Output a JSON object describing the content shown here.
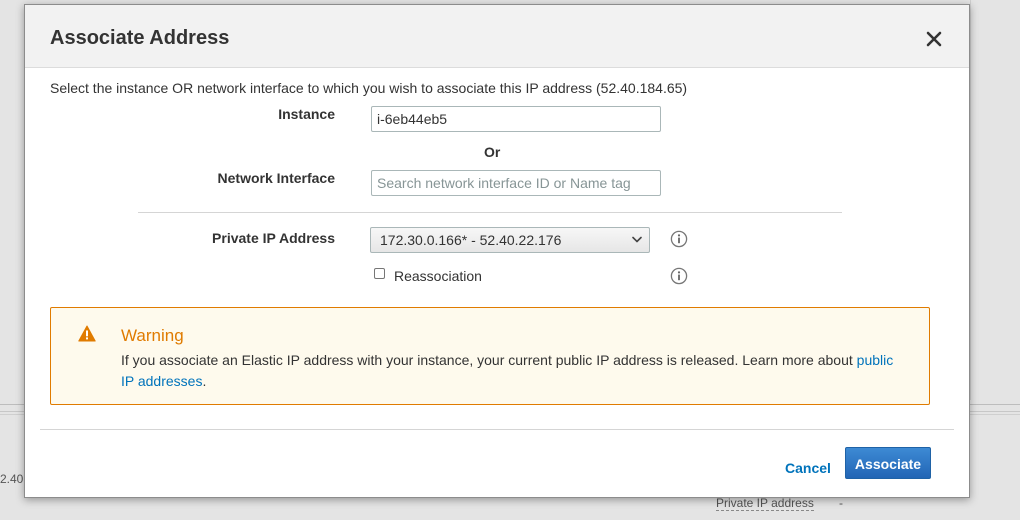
{
  "background": {
    "left_text": "2.40",
    "private_ip_label": "Private IP address",
    "private_ip_value": "-"
  },
  "modal": {
    "title": "Associate Address",
    "close_icon": "close-icon",
    "intro": "Select the instance OR network interface to which you wish to associate this IP address (52.40.184.65)",
    "instance": {
      "label": "Instance",
      "value": "i-6eb44eb5"
    },
    "or_text": "Or",
    "network_interface": {
      "label": "Network Interface",
      "placeholder": "Search network interface ID or Name tag"
    },
    "private_ip": {
      "label": "Private IP Address",
      "selected": "172.30.0.166* - 52.40.22.176"
    },
    "reassociation": {
      "label": "Reassociation",
      "checked": false
    },
    "warning": {
      "icon": "warning-icon",
      "title": "Warning",
      "text": "If you associate an Elastic IP address with your instance, your current public IP address is released. Learn more about",
      "link": "public IP addresses",
      "trailing": "."
    },
    "buttons": {
      "cancel": "Cancel",
      "associate": "Associate"
    }
  },
  "colors": {
    "warning_border": "#e07b00",
    "warning_bg": "#fefaed",
    "link": "#0073bb",
    "primary_button": "#2a72c3"
  }
}
